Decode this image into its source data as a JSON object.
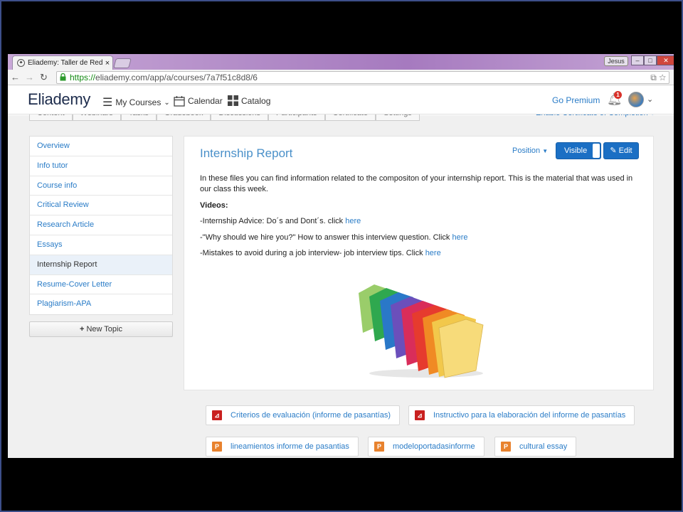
{
  "browser": {
    "tab_title": "Eliademy: Taller de Redac",
    "tab_close": "×",
    "user_chip": "Jesus",
    "url_scheme": "https://",
    "url_rest": "eliademy.com/app/a/courses/7a7f51c8d8/6"
  },
  "navbar": {
    "logo": "Eliademy",
    "my_courses": "My Courses",
    "calendar": "Calendar",
    "catalog": "Catalog",
    "go_premium": "Go Premium",
    "notification_count": "1"
  },
  "course_tabs": [
    "Content",
    "Webinars",
    "Tasks",
    "Gradebook",
    "Discussions",
    "Participants",
    "Certificate",
    "Settings"
  ],
  "certificate_link": "Enable Certificate of Completion",
  "sidebar": {
    "items": [
      {
        "label": "Overview"
      },
      {
        "label": "Info tutor"
      },
      {
        "label": "Course info"
      },
      {
        "label": "Critical Review"
      },
      {
        "label": "Research Article"
      },
      {
        "label": "Essays"
      },
      {
        "label": "Internship Report",
        "active": true
      },
      {
        "label": "Resume-Cover Letter"
      },
      {
        "label": "Plagiarism-APA"
      }
    ],
    "new_topic": "New Topic"
  },
  "content": {
    "title": "Internship Report",
    "position": "Position",
    "visible": "Visible",
    "edit": "Edit",
    "intro": "In these files you can find information related to the compositon of your internship report. This is the material that was used in our class this week.",
    "videos_heading": "Videos:",
    "lines": [
      {
        "text": "-Internship Advice: Do´s and Dont´s. click ",
        "link": "here"
      },
      {
        "text": "-\"Why should we hire you?\" How to answer this interview question. Click ",
        "link": "here"
      },
      {
        "text": "-Mistakes to avoid during a job interview- job interview tips. Click ",
        "link": "here"
      }
    ]
  },
  "attachments": [
    {
      "label": "Criterios de evaluación (informe de pasantías)",
      "type": "pdf",
      "icon": "pdf-icon"
    },
    {
      "label": "Instructivo para la elaboración del informe de pasantías",
      "type": "pdf",
      "icon": "pdf-icon"
    },
    {
      "label": "lineamientos informe de pasantias",
      "type": "ppt",
      "icon": "powerpoint-icon"
    },
    {
      "label": "modeloportadasinforme",
      "type": "ppt",
      "icon": "powerpoint-icon"
    },
    {
      "label": "cultural essay",
      "type": "ppt",
      "icon": "powerpoint-icon"
    }
  ],
  "colors": {
    "accent": "#2a7cc7",
    "primary_button": "#1b6fc4",
    "title_blue": "#4a90c9",
    "pdf_red": "#c9201f",
    "ppt_orange": "#e8822e"
  }
}
